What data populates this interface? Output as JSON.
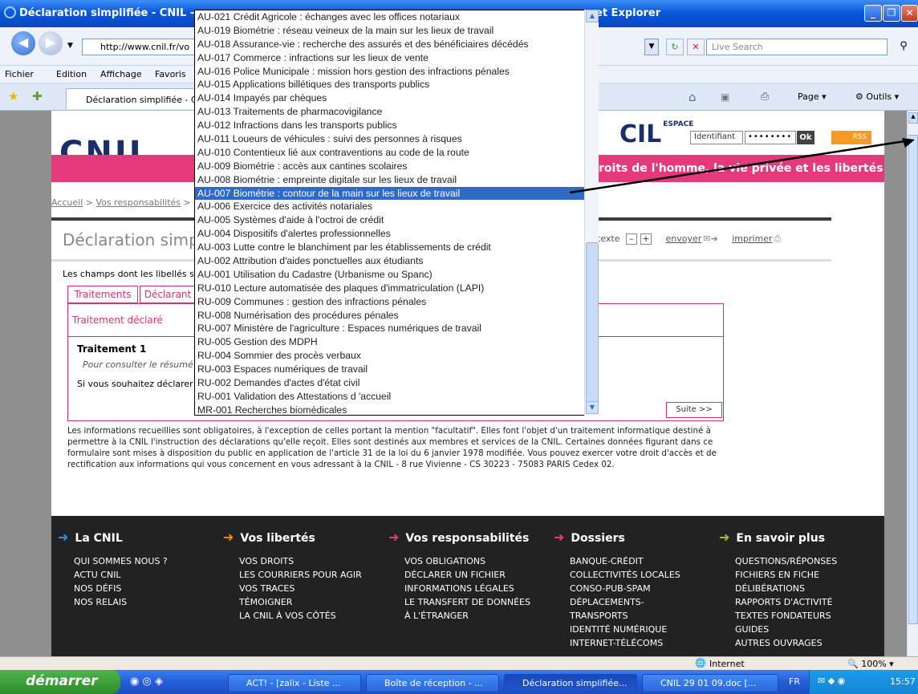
{
  "window": {
    "title": "Déclaration simplifiée - CNIL -",
    "title_suffix": "et Explorer"
  },
  "address": {
    "url": "http://www.cnil.fr/vo",
    "search_placeholder": "Live Search"
  },
  "menu": [
    "Fichier",
    "Edition",
    "Affichage",
    "Favoris"
  ],
  "tab": {
    "title": "Déclaration simplifiée - CN"
  },
  "ie_toolbar": {
    "page": "Page",
    "tools": "Outils"
  },
  "site": {
    "logo": "CNIL",
    "cil": "CIL",
    "cil_sup": "ESPACE",
    "login": {
      "ident_placeholder": "Identifiant",
      "password": "••••••••",
      "ok": "Ok",
      "rss": "RSS"
    },
    "tagline": "droits de l'homme, la vie privée et les libertés",
    "breadcrumb": [
      "Accueil",
      "Vos responsabilités"
    ],
    "heading": "Déclaration simp",
    "tools": {
      "text_label": "texte",
      "minus": "–",
      "plus": "+",
      "send": "envoyer",
      "print": "imprimer"
    },
    "champs": "Les champs dont les libellés so",
    "tabs": [
      "Traitements",
      "Déclarant"
    ],
    "panel_title": "Traitement déclaré",
    "treatment": {
      "title": "Traitement 1",
      "hint": "Pour consulter le résumé",
      "declare": "Si vous souhaitez déclarer"
    },
    "suite": "Suite >>",
    "notice": "Les informations recueillies sont obligatoires, à l'exception de celles portant la mention \"facultatif\". Elles font l'objet d'un traitement informatique destiné à permettre à la CNIL l'instruction des déclarations qu'elle reçoit. Elles sont destinés aux membres et services de la CNIL. Certaines données figurant dans ce formulaire sont mises à disposition du public en application de l'article 31 de la loi du 6 janvier 1978 modifiée. Vous pouvez exercer votre droit d'accès et de rectification aux informations qui vous concernent en vous adressant à la CNIL - 8 rue Vivienne - CS 30223 - 75083 PARIS Cedex 02."
  },
  "footer": [
    {
      "title": "La CNIL",
      "color": "#2f8fe0",
      "items": [
        "QUI SOMMES NOUS ?",
        "ACTU CNIL",
        "NOS DÉFIS",
        "NOS RELAIS"
      ]
    },
    {
      "title": "Vos libertés",
      "color": "#f08a1c",
      "items": [
        "VOS DROITS",
        "LES COURRIERS POUR AGIR",
        "VOS TRACES",
        "TÉMOIGNER",
        "LA CNIL À VOS CÔTÉS"
      ]
    },
    {
      "title": "Vos responsabilités",
      "color": "#e4397a",
      "items": [
        "VOS OBLIGATIONS",
        "DÉCLARER UN FICHIER",
        "INFORMATIONS LÉGALES",
        "LE TRANSFERT DE DONNÉES",
        "À L'ÉTRANGER"
      ]
    },
    {
      "title": "Dossiers",
      "color": "#e4397a",
      "items": [
        "BANQUE-CRÉDIT",
        "COLLECTIVITÉS LOCALES",
        "CONSO-PUB-SPAM",
        "DÉPLACEMENTS-",
        "TRANSPORTS",
        "IDENTITÉ NUMÉRIQUE",
        "INTERNET-TÉLÉCOMS"
      ]
    },
    {
      "title": "En savoir plus",
      "color": "#8cc63e",
      "items": [
        "QUESTIONS/RÉPONSES",
        "FICHIERS EN FICHE",
        "DÉLIBÉRATIONS",
        "RAPPORTS D'ACTIVITÉ",
        "TEXTES FONDATEURS",
        "GUIDES",
        "AUTRES OUVRAGES"
      ]
    }
  ],
  "dropdown": {
    "selected_index": 13,
    "options": [
      "AU-021 Crédit Agricole : échanges avec les offices notariaux",
      "AU-019 Biométrie : réseau veineux de la main sur les lieux de travail",
      "AU-018 Assurance-vie : recherche des assurés et des bénéficiaires décédés",
      "AU-017 Commerce : infractions sur les lieux de vente",
      "AU-016 Police Municipale : mission hors gestion des infractions pénales",
      "AU-015 Applications billétiques des transports publics",
      "AU-014 Impayés par chèques",
      "AU-013 Traitements de pharmacovigilance",
      "AU-012 Infractions dans les transports publics",
      "AU-011 Loueurs de véhicules : suivi des personnes à risques",
      "AU-010 Contentieux lié aux contraventions au code de la route",
      "AU-009 Biométrie : accès aux cantines scolaires",
      "AU-008 Biométrie : empreinte digitale sur les lieux de travail",
      "AU-007 Biométrie : contour de la main sur les lieux de travail",
      "AU-006 Exercice des activités notariales",
      "AU-005 Systèmes d'aide à l'octroi de crédit",
      "AU-004 Dispositifs d'alertes professionnelles",
      "AU-003 Lutte contre le blanchiment par les établissements de crédit",
      "AU-002 Attribution d'aides ponctuelles aux étudiants",
      "AU-001 Utilisation du Cadastre (Urbanisme ou Spanc)",
      "RU-010 Lecture automatisée des plaques d'immatriculation (LAPI)",
      "RU-009 Communes : gestion des infractions pénales",
      "RU-008 Numérisation des procédures pénales",
      "RU-007 Ministère de l'agriculture : Espaces numériques de travail",
      "RU-005 Gestion des MDPH",
      "RU-004 Sommier des procès verbaux",
      "RU-003 Espaces numériques de travail",
      "RU-002 Demandes d'actes d'état civil",
      "RU-001 Validation des Attestations d 'accueil",
      "MR-001 Recherches biomédicales"
    ]
  },
  "status": {
    "zone": "Internet",
    "zoom": "100%"
  },
  "taskbar": {
    "start": "démarrer",
    "tasks": [
      "ACT! - [zalix - Liste ...",
      "Boîte de réception - ...",
      "Déclaration simplifiée...",
      "CNIL 29 01 09.doc [..."
    ],
    "lang": "FR",
    "clock": "15:57"
  }
}
